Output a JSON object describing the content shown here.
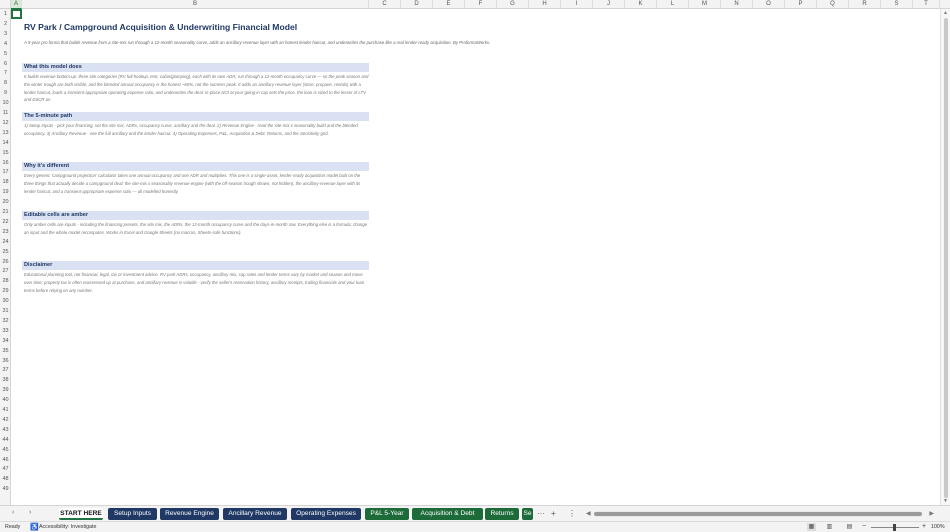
{
  "columns": [
    "A",
    "B",
    "C",
    "D",
    "E",
    "F",
    "G",
    "H",
    "I",
    "J",
    "K",
    "L",
    "M",
    "N",
    "O",
    "P",
    "Q",
    "R",
    "S",
    "T"
  ],
  "rows": [
    "1",
    "2",
    "3",
    "4",
    "5",
    "6",
    "7",
    "8",
    "9",
    "10",
    "11",
    "12",
    "13",
    "14",
    "15",
    "16",
    "17",
    "18",
    "19",
    "20",
    "21",
    "22",
    "23",
    "24",
    "25",
    "26",
    "27",
    "28",
    "29",
    "30",
    "31",
    "32",
    "33",
    "34",
    "35",
    "36",
    "37",
    "38",
    "39",
    "40",
    "41",
    "42",
    "43",
    "44",
    "45",
    "46",
    "47",
    "48",
    "49"
  ],
  "sheet": {
    "title": "RV Park / Campground Acquisition & Underwriting Financial Model",
    "subtitle": "A 5-year pro forma that builds revenue from a site-mix run through a 12-month seasonality curve, adds an ancillary-revenue layer with an honest lender haircut, and underwrites the purchase like a real lender-ready acquisition. By ProformaWorks.",
    "sections": [
      {
        "heading": "What this model does",
        "body": "It builds revenue bottom-up: three site categories (RV full-hookup, tent, cabin/glamping), each with its own ADR, run through a 12-month occupancy curve — so the peak season and the winter trough are both visible, and the blended annual occupancy is the honest ~65%, not the summer peak. It adds an ancillary-revenue layer (store, propane, rentals) with a lender haircut, loads a transient-appropriate operating expense ratio, and underwrites the deal: in-place NOI at your going-in cap sets the price, the loan is sized to the lesser of LTV and DSCR on"
      },
      {
        "heading": "The 5-minute path",
        "body": "1) Setup Inputs - pick your financing, set the site mix, ADRs, occupancy curve, ancillary and the deal.  2) Revenue Engine - read the site-mix x seasonality build and the blended occupancy.  3) Ancillary Revenue - see the full ancillary and the lender haircut.  4) Operating Expenses, P&L, Acquisition & Debt, Returns, and the Sensitivity grid."
      },
      {
        "heading": "Why it's different",
        "body": "Every generic 'campground projection' calculator takes one annual occupancy and one ADR and multiplies. This one is a single-asset, lender-ready acquisition model built on the three things that actually decide a campground deal: the site-mix x seasonality revenue engine (with the off-season trough shown, not hidden), the ancillary-revenue layer with its lender haircut, and a transient-appropriate expense ratio — all modelled honestly."
      },
      {
        "heading": "Editable cells are amber",
        "body": "Only amber cells are inputs - including the financing presets, the site mix, the ADRs, the 12-month occupancy curve and the days-in-month row. Everything else is a formula; change an input and the whole model recomputes. Works in Excel and Google Sheets (no macros, Sheets-safe functions)."
      },
      {
        "heading": "Disclaimer",
        "body": "Educational planning tool, not financial, legal, tax or investment advice. RV park ADRs, occupancy, ancillary mix, cap rates and lender terms vary by market and season and move over time; property tax is often reassessed up at purchase, and ancillary revenue is volatile - verify the seller's reservation history, ancillary receipts, trailing financials and your loan terms before relying on any number."
      }
    ]
  },
  "tabs": [
    {
      "label": "START HERE",
      "style": "active"
    },
    {
      "label": "Setup Inputs",
      "style": "navy"
    },
    {
      "label": "Revenue Engine",
      "style": "navy"
    },
    {
      "label": "Ancillary Revenue",
      "style": "navy"
    },
    {
      "label": "Operating Expenses",
      "style": "navy"
    },
    {
      "label": "P&L 5-Year",
      "style": "green"
    },
    {
      "label": "Acquisition & Debt",
      "style": "green"
    },
    {
      "label": "Returns",
      "style": "green"
    },
    {
      "label": "Se",
      "style": "green"
    }
  ],
  "tab_controls": {
    "prev": "‹",
    "next": "›",
    "more": "···",
    "add": "+",
    "options": "⋮"
  },
  "status": {
    "ready": "Ready",
    "accessibility": "Accessibility: Investigate",
    "zoom": "100%",
    "zoom_minus": "−",
    "zoom_plus": "+"
  },
  "colors": {
    "accent": "#217346",
    "heading_fill": "#d9e1f2",
    "title": "#1f3864",
    "tab_navy": "#1f3864",
    "tab_green": "#1e6b3a"
  },
  "icons": {
    "accessibility": "accessibility-icon",
    "normal_view": "grid-view-icon",
    "page_layout": "page-layout-icon",
    "page_break": "page-break-icon"
  }
}
